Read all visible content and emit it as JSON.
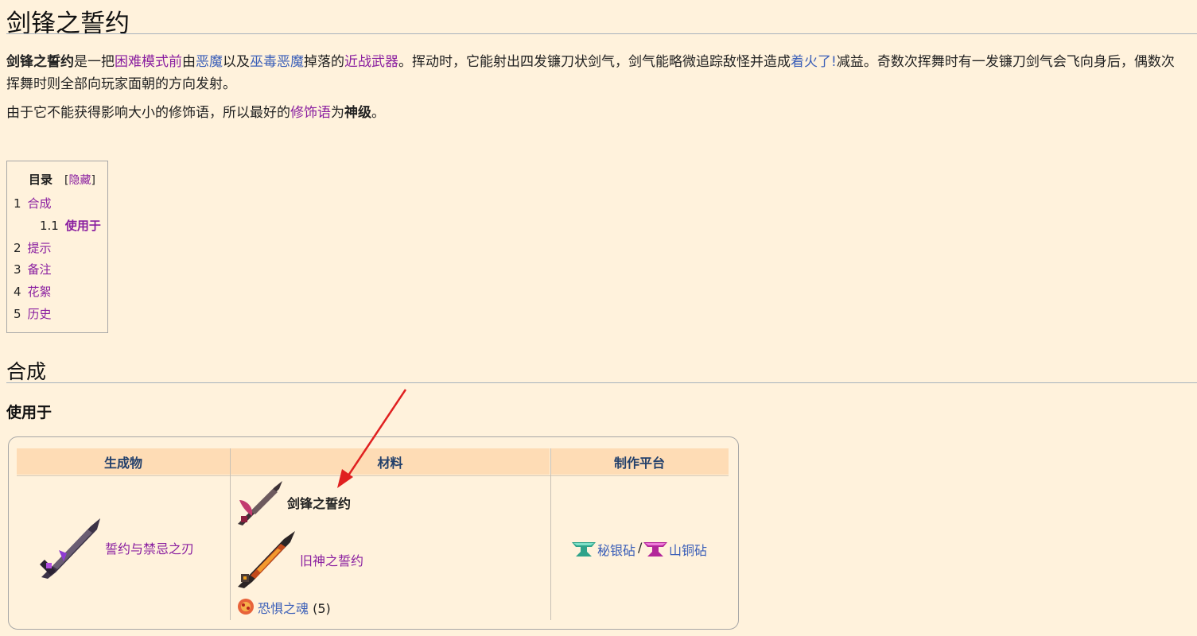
{
  "page": {
    "title": "剑锋之誓约"
  },
  "intro": {
    "subject": "剑锋之誓约",
    "t1": "是一把",
    "link_hardmode": "困难模式前",
    "t2": "由",
    "link_demon": "恶魔",
    "t3": "以及",
    "link_voodoo": "巫毒恶魔",
    "t4": "掉落的",
    "link_melee": "近战武器",
    "t5": "。挥动时，它能射出四发镰刀状剑气，剑气能略微追踪敌怪并造成",
    "link_onfire": "着火了!",
    "t6": "减益。奇数次挥舞时有一发镰刀剑气会飞向身后，偶数次挥舞时则全部向玩家面朝的方向发射。"
  },
  "modifier": {
    "t1": "由于它不能获得影响大小的修饰语，所以最好的",
    "link_modifier": "修饰语",
    "t2": "为",
    "best": "神级",
    "t3": "。"
  },
  "toc": {
    "title": "目录",
    "bracket_open": "[",
    "toggle": "隐藏",
    "bracket_close": "]",
    "items": [
      {
        "num": "1",
        "label": "合成"
      },
      {
        "num": "1.1",
        "label": "使用于"
      },
      {
        "num": "2",
        "label": "提示"
      },
      {
        "num": "3",
        "label": "备注"
      },
      {
        "num": "4",
        "label": "花絮"
      },
      {
        "num": "5",
        "label": "历史"
      }
    ]
  },
  "section": {
    "heading": "合成",
    "subheading": "使用于"
  },
  "recipe": {
    "headers": [
      "生成物",
      "材料",
      "制作平台"
    ],
    "result": "誓约与禁忌之刃",
    "ingredients": [
      {
        "name": "剑锋之誓约",
        "qty": ""
      },
      {
        "name": "旧神之誓约",
        "qty": ""
      },
      {
        "name": "恐惧之魂",
        "qty": "(5)"
      }
    ],
    "station_1": "秘银砧",
    "station_sep": "/",
    "station_2": "山铜砧"
  },
  "colors": {
    "background": "#fff2dc",
    "link_purple": "#8a1fa0",
    "link_blue": "#3b5fb8",
    "table_header_bg": "#fedcb5",
    "annotation_arrow": "#e02020"
  },
  "icons": [
    "sword-icon",
    "blade-icon",
    "soul-of-fright-icon",
    "mythril-anvil-icon",
    "orichalcum-anvil-icon"
  ]
}
